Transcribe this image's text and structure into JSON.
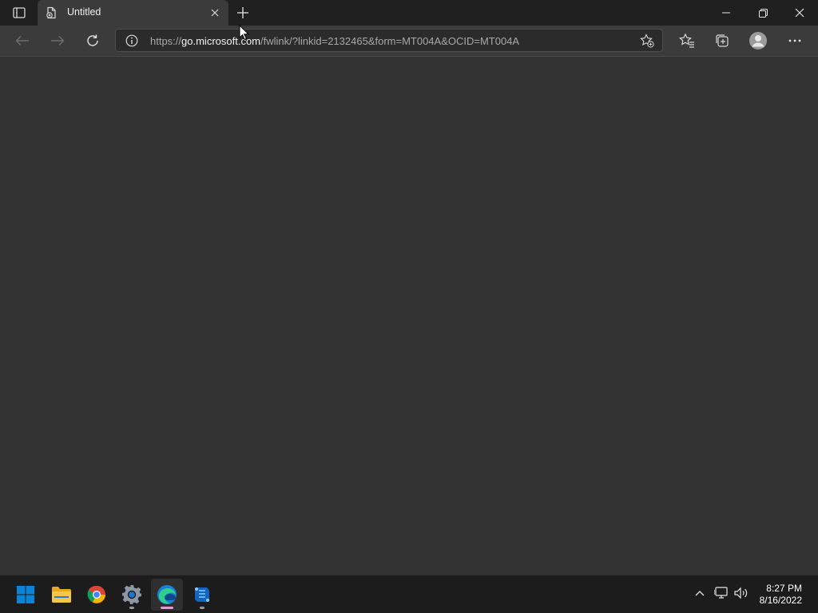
{
  "browser": {
    "tab": {
      "title": "Untitled"
    },
    "address": {
      "prefix": "https://",
      "host": "go.microsoft.com",
      "path": "/fwlink/?linkid=2132465&form=MT004A&OCID=MT004A"
    },
    "icons": {
      "tab_actions": "tab-actions-icon",
      "favicon": "page-error-icon",
      "tab_close": "close-icon",
      "new_tab": "plus-icon",
      "minimize": "minimize-icon",
      "restore": "restore-icon",
      "close": "close-icon",
      "back": "back-arrow-icon",
      "forward": "forward-arrow-icon",
      "refresh": "refresh-icon",
      "site_info": "info-icon",
      "add_favorite": "star-add-icon",
      "favorites": "favorites-icon",
      "collections": "collections-icon",
      "profile": "profile-icon",
      "more": "more-icon"
    }
  },
  "taskbar": {
    "apps": [
      "start",
      "file-explorer",
      "chrome",
      "settings",
      "edge",
      "azure-data-studio"
    ],
    "clock": {
      "time": "8:27 PM",
      "date": "8/16/2022"
    }
  },
  "colors": {
    "background": "#333333",
    "tabbar": "#202020",
    "toolbar": "#3b3b3b",
    "taskbar": "#1c1c1c",
    "accent_blue": "#0a84d8",
    "edge_indicator": "#e39bd8"
  }
}
